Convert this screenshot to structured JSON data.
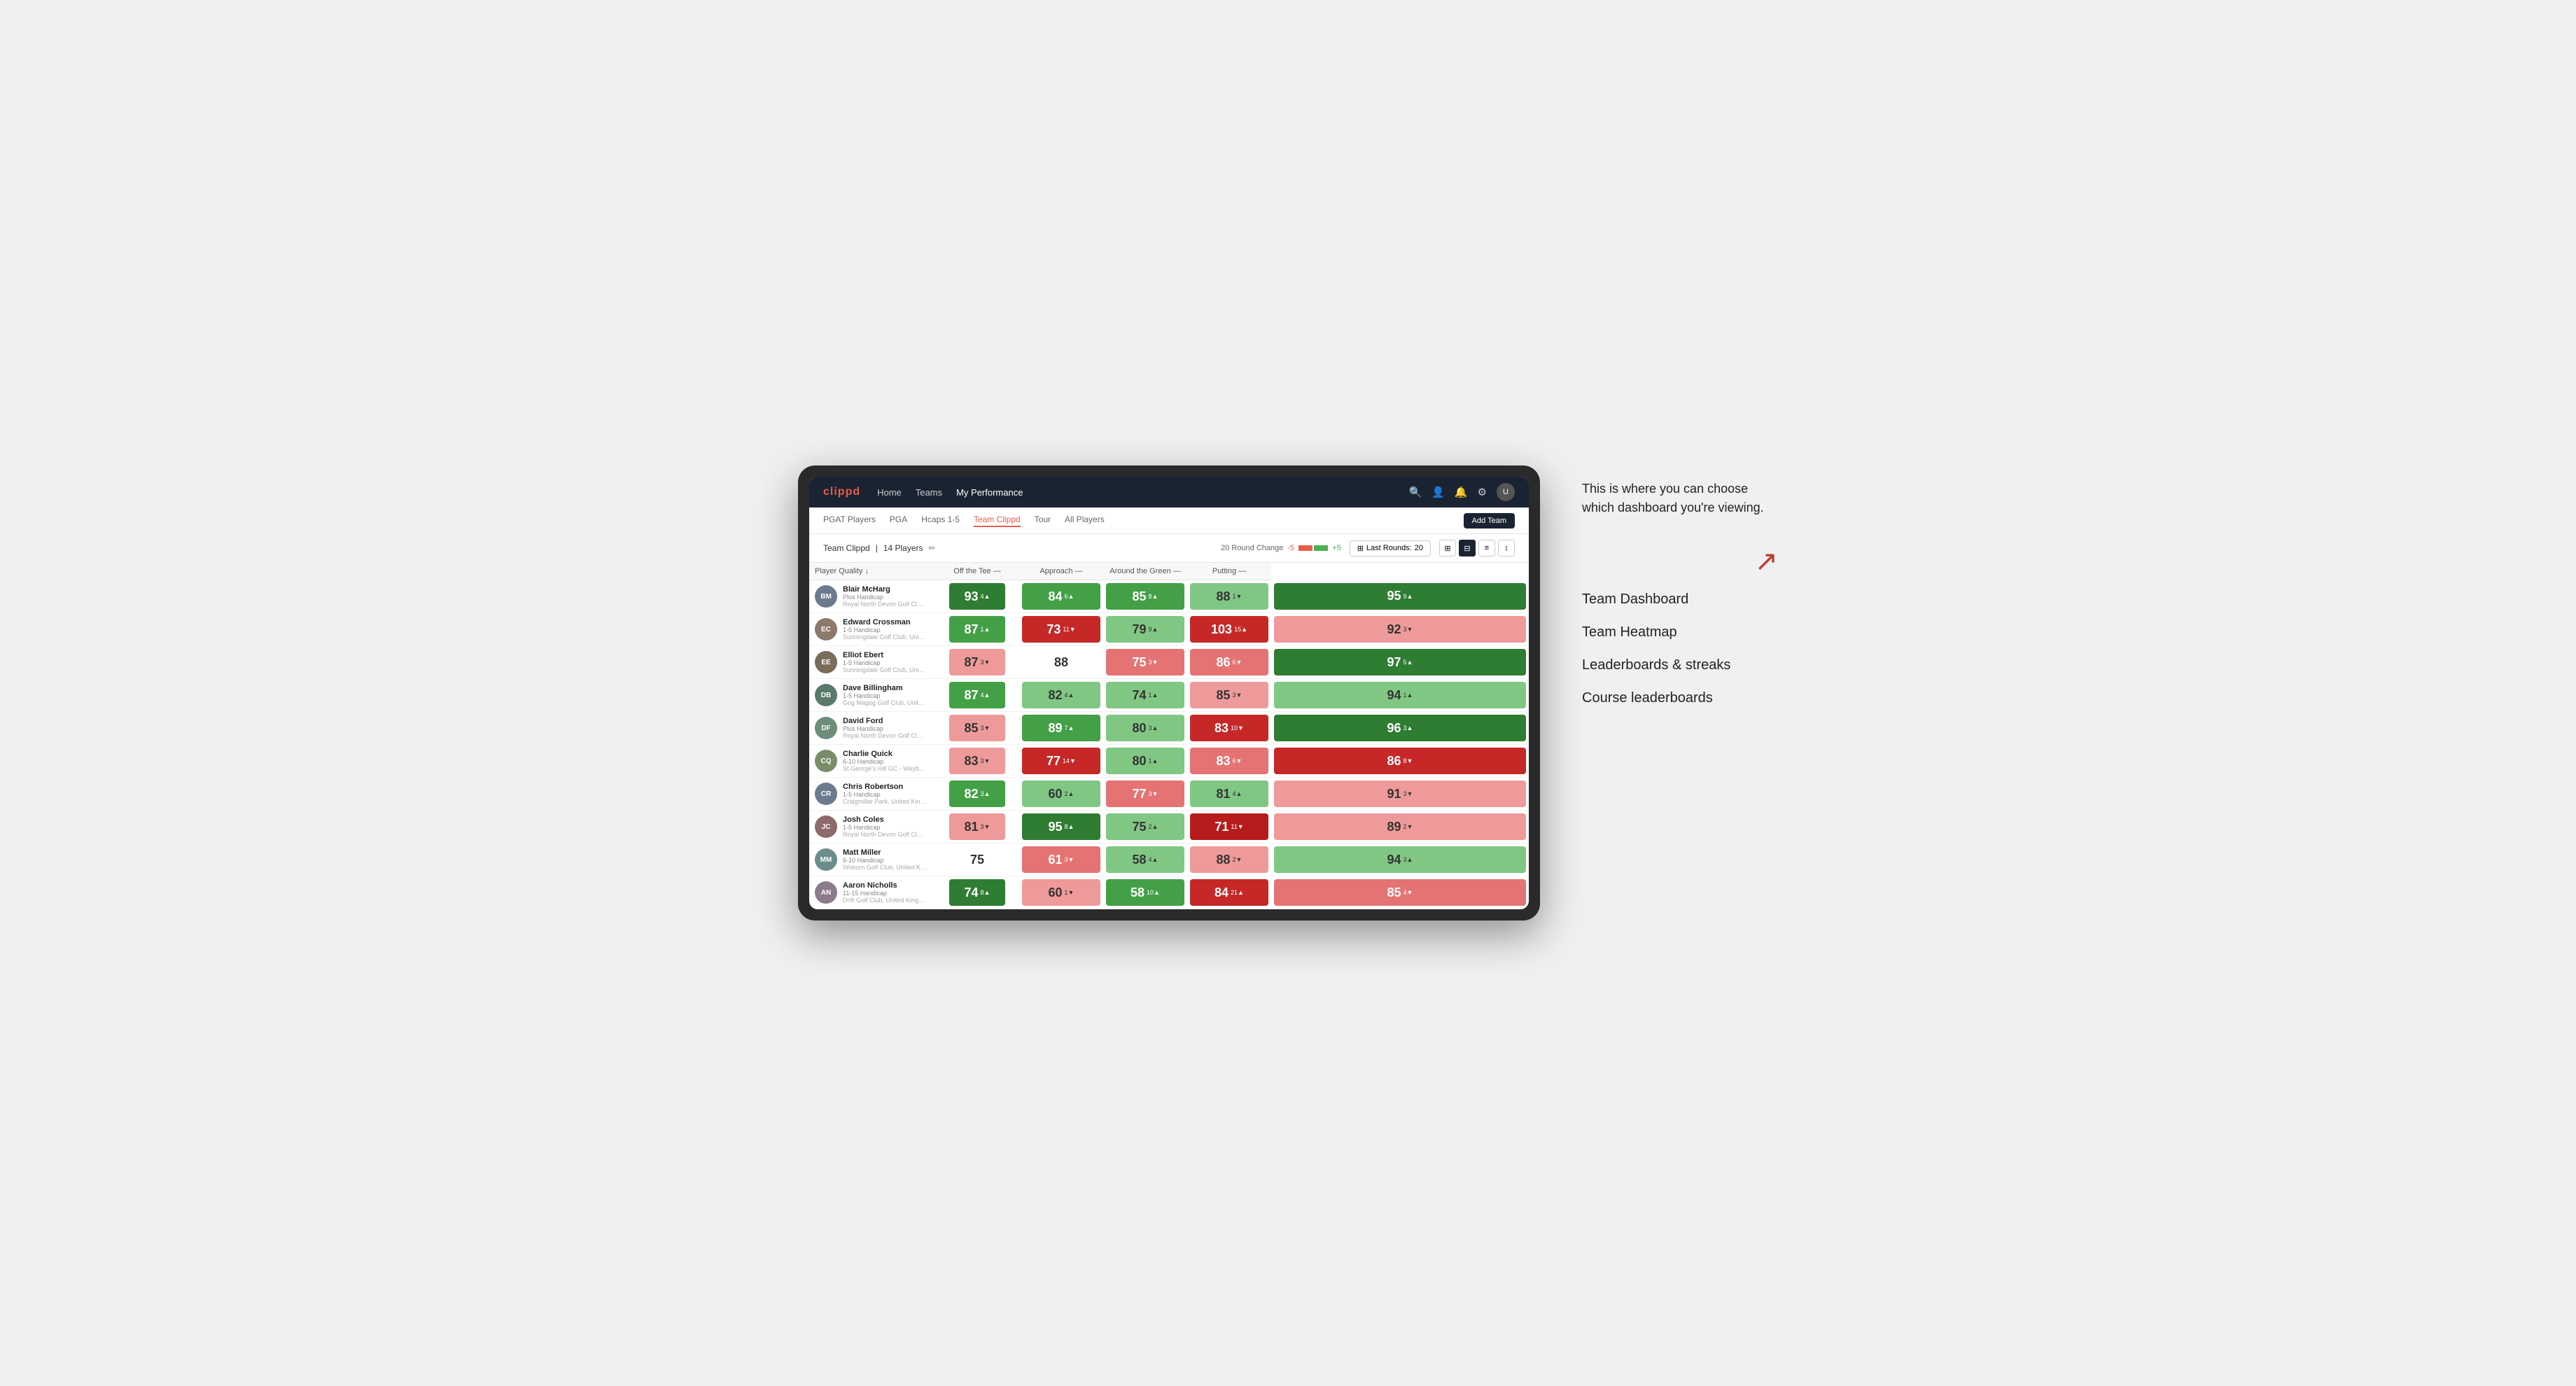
{
  "annotation": {
    "intro": "This is where you can choose which dashboard you're viewing.",
    "items": [
      "Team Dashboard",
      "Team Heatmap",
      "Leaderboards & streaks",
      "Course leaderboards"
    ]
  },
  "nav": {
    "logo": "clippd",
    "links": [
      "Home",
      "Teams",
      "My Performance"
    ],
    "active_link": "My Performance"
  },
  "sub_nav": {
    "links": [
      "PGAT Players",
      "PGA",
      "Hcaps 1-5",
      "Team Clippd",
      "Tour",
      "All Players"
    ],
    "active": "Team Clippd",
    "add_team": "Add Team"
  },
  "team_header": {
    "name": "Team Clippd",
    "separator": "|",
    "count": "14 Players",
    "round_change_label": "20 Round Change",
    "change_neg": "-5",
    "change_pos": "+5",
    "last_rounds_label": "Last Rounds:",
    "last_rounds_value": "20"
  },
  "table": {
    "columns": {
      "player": "Player Quality ↓",
      "off_tee": "Off the Tee —",
      "approach": "Approach —",
      "around_green": "Around the Green —",
      "putting": "Putting —"
    },
    "players": [
      {
        "name": "Blair McHarg",
        "handicap": "Plus Handicap",
        "club": "Royal North Devon Golf Club, United Kingdom",
        "initials": "BM",
        "bg": "#6b7a8d",
        "scores": {
          "quality": {
            "value": "93",
            "change": "4",
            "dir": "up",
            "color": "green-dark"
          },
          "off_tee": {
            "value": "84",
            "change": "6",
            "dir": "up",
            "color": "green-mid"
          },
          "approach": {
            "value": "85",
            "change": "8",
            "dir": "up",
            "color": "green-mid"
          },
          "around_green": {
            "value": "88",
            "change": "1",
            "dir": "down",
            "color": "green-light"
          },
          "putting": {
            "value": "95",
            "change": "9",
            "dir": "up",
            "color": "green-dark"
          }
        }
      },
      {
        "name": "Edward Crossman",
        "handicap": "1-5 Handicap",
        "club": "Sunningdale Golf Club, United Kingdom",
        "initials": "EC",
        "bg": "#8d7a6b",
        "scores": {
          "quality": {
            "value": "87",
            "change": "1",
            "dir": "up",
            "color": "green-mid"
          },
          "off_tee": {
            "value": "73",
            "change": "11",
            "dir": "down",
            "color": "red-dark"
          },
          "approach": {
            "value": "79",
            "change": "9",
            "dir": "up",
            "color": "green-light"
          },
          "around_green": {
            "value": "103",
            "change": "15",
            "dir": "up",
            "color": "red-dark"
          },
          "putting": {
            "value": "92",
            "change": "3",
            "dir": "down",
            "color": "red-light"
          }
        }
      },
      {
        "name": "Elliot Ebert",
        "handicap": "1-5 Handicap",
        "club": "Sunningdale Golf Club, United Kingdom",
        "initials": "EE",
        "bg": "#7a6b5a",
        "scores": {
          "quality": {
            "value": "87",
            "change": "3",
            "dir": "down",
            "color": "red-light"
          },
          "off_tee": {
            "value": "88",
            "change": "",
            "dir": "",
            "color": "white"
          },
          "approach": {
            "value": "75",
            "change": "3",
            "dir": "down",
            "color": "red-mid"
          },
          "around_green": {
            "value": "86",
            "change": "6",
            "dir": "down",
            "color": "red-mid"
          },
          "putting": {
            "value": "97",
            "change": "5",
            "dir": "up",
            "color": "green-dark"
          }
        }
      },
      {
        "name": "Dave Billingham",
        "handicap": "1-5 Handicap",
        "club": "Gog Magog Golf Club, United Kingdom",
        "initials": "DB",
        "bg": "#5a7a6b",
        "scores": {
          "quality": {
            "value": "87",
            "change": "4",
            "dir": "up",
            "color": "green-mid"
          },
          "off_tee": {
            "value": "82",
            "change": "4",
            "dir": "up",
            "color": "green-light"
          },
          "approach": {
            "value": "74",
            "change": "1",
            "dir": "up",
            "color": "green-light"
          },
          "around_green": {
            "value": "85",
            "change": "3",
            "dir": "down",
            "color": "red-light"
          },
          "putting": {
            "value": "94",
            "change": "1",
            "dir": "up",
            "color": "green-light"
          }
        }
      },
      {
        "name": "David Ford",
        "handicap": "Plus Handicap",
        "club": "Royal North Devon Golf Club, United Kingdom",
        "initials": "DF",
        "bg": "#6b8d7a",
        "scores": {
          "quality": {
            "value": "85",
            "change": "3",
            "dir": "down",
            "color": "red-light"
          },
          "off_tee": {
            "value": "89",
            "change": "7",
            "dir": "up",
            "color": "green-mid"
          },
          "approach": {
            "value": "80",
            "change": "3",
            "dir": "up",
            "color": "green-light"
          },
          "around_green": {
            "value": "83",
            "change": "10",
            "dir": "down",
            "color": "red-dark"
          },
          "putting": {
            "value": "96",
            "change": "3",
            "dir": "up",
            "color": "green-dark"
          }
        }
      },
      {
        "name": "Charlie Quick",
        "handicap": "6-10 Handicap",
        "club": "St George's Hill GC - Weybridge - Surrey, Uni...",
        "initials": "CQ",
        "bg": "#7a8d6b",
        "scores": {
          "quality": {
            "value": "83",
            "change": "3",
            "dir": "down",
            "color": "red-light"
          },
          "off_tee": {
            "value": "77",
            "change": "14",
            "dir": "down",
            "color": "red-dark"
          },
          "approach": {
            "value": "80",
            "change": "1",
            "dir": "up",
            "color": "green-light"
          },
          "around_green": {
            "value": "83",
            "change": "6",
            "dir": "down",
            "color": "red-mid"
          },
          "putting": {
            "value": "86",
            "change": "8",
            "dir": "down",
            "color": "red-dark"
          }
        }
      },
      {
        "name": "Chris Robertson",
        "handicap": "1-5 Handicap",
        "club": "Craigmillar Park, United Kingdom",
        "initials": "CR",
        "bg": "#6b7a8d",
        "scores": {
          "quality": {
            "value": "82",
            "change": "3",
            "dir": "up",
            "color": "green-mid"
          },
          "off_tee": {
            "value": "60",
            "change": "2",
            "dir": "up",
            "color": "green-light"
          },
          "approach": {
            "value": "77",
            "change": "3",
            "dir": "down",
            "color": "red-mid"
          },
          "around_green": {
            "value": "81",
            "change": "4",
            "dir": "up",
            "color": "green-light"
          },
          "putting": {
            "value": "91",
            "change": "3",
            "dir": "down",
            "color": "red-light"
          }
        }
      },
      {
        "name": "Josh Coles",
        "handicap": "1-5 Handicap",
        "club": "Royal North Devon Golf Club, United Kingdom",
        "initials": "JC",
        "bg": "#8d6b6b",
        "scores": {
          "quality": {
            "value": "81",
            "change": "3",
            "dir": "down",
            "color": "red-light"
          },
          "off_tee": {
            "value": "95",
            "change": "8",
            "dir": "up",
            "color": "green-dark"
          },
          "approach": {
            "value": "75",
            "change": "2",
            "dir": "up",
            "color": "green-light"
          },
          "around_green": {
            "value": "71",
            "change": "11",
            "dir": "down",
            "color": "red-deep"
          },
          "putting": {
            "value": "89",
            "change": "2",
            "dir": "down",
            "color": "red-light"
          }
        }
      },
      {
        "name": "Matt Miller",
        "handicap": "6-10 Handicap",
        "club": "Woburn Golf Club, United Kingdom",
        "initials": "MM",
        "bg": "#6b8d8d",
        "scores": {
          "quality": {
            "value": "75",
            "change": "",
            "dir": "",
            "color": "white"
          },
          "off_tee": {
            "value": "61",
            "change": "3",
            "dir": "down",
            "color": "red-mid"
          },
          "approach": {
            "value": "58",
            "change": "4",
            "dir": "up",
            "color": "green-light"
          },
          "around_green": {
            "value": "88",
            "change": "2",
            "dir": "down",
            "color": "red-light"
          },
          "putting": {
            "value": "94",
            "change": "3",
            "dir": "up",
            "color": "green-light"
          }
        }
      },
      {
        "name": "Aaron Nicholls",
        "handicap": "11-15 Handicap",
        "club": "Drift Golf Club, United Kingdom",
        "initials": "AN",
        "bg": "#8d7a8d",
        "scores": {
          "quality": {
            "value": "74",
            "change": "8",
            "dir": "up",
            "color": "green-dark"
          },
          "off_tee": {
            "value": "60",
            "change": "1",
            "dir": "down",
            "color": "red-light"
          },
          "approach": {
            "value": "58",
            "change": "10",
            "dir": "up",
            "color": "green-mid"
          },
          "around_green": {
            "value": "84",
            "change": "21",
            "dir": "up",
            "color": "red-dark"
          },
          "putting": {
            "value": "85",
            "change": "4",
            "dir": "down",
            "color": "red-mid"
          }
        }
      }
    ]
  }
}
